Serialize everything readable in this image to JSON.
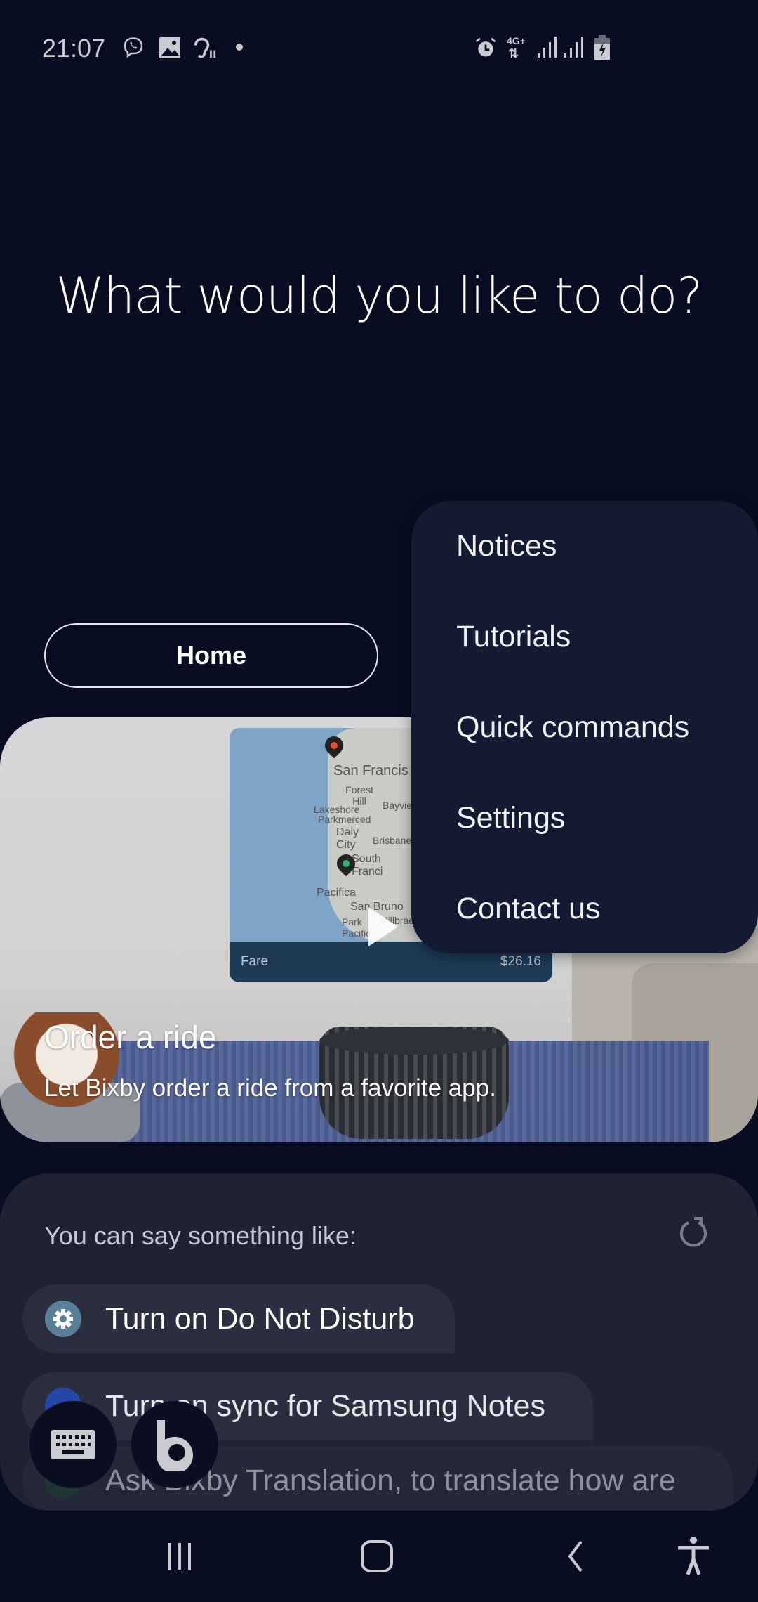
{
  "status_bar": {
    "time": "21:07",
    "left_icons": [
      "viber-icon",
      "gallery-icon",
      "hearing-icon",
      "dot-icon"
    ],
    "right_icons": [
      "alarm-icon",
      "4g-plus-icon",
      "signal-icon",
      "signal-icon",
      "battery-charging-icon"
    ],
    "network": "4G+"
  },
  "header": {
    "title": "What would you like to do?"
  },
  "home_button": {
    "label": "Home"
  },
  "card": {
    "title": "Order a ride",
    "subtitle": "Let Bixby order a ride from a favorite app.",
    "map": {
      "labels": [
        "San Francis",
        "Forest Hill",
        "Lakeshore",
        "Parkmerced",
        "Daly City",
        "Brisbane",
        "Bayview",
        "South Franci",
        "Pacifica",
        "San Bruno",
        "Park Pacific",
        "Millbrae"
      ],
      "fare_label": "Fare",
      "fare_value": "$26.16"
    }
  },
  "menu": {
    "items": [
      {
        "label": "Notices"
      },
      {
        "label": "Tutorials"
      },
      {
        "label": "Quick commands"
      },
      {
        "label": "Settings"
      },
      {
        "label": "Contact us"
      }
    ]
  },
  "suggestions": {
    "heading": "You can say something like:",
    "items": [
      {
        "label": "Turn on Do Not Disturb",
        "icon": "settings-gear-icon",
        "color": "#5a7f99"
      },
      {
        "label": "Turn on sync for Samsung Notes",
        "icon": "samsung-cloud-icon",
        "color": "#2447a8"
      },
      {
        "label": "Ask Bixby Translation, to translate how are",
        "icon": "translation-icon",
        "color": "#1f4a3a"
      }
    ]
  },
  "fabs": [
    {
      "icon": "keyboard-icon"
    },
    {
      "icon": "bixby-icon"
    }
  ],
  "nav_bar": {
    "icons": [
      "recents-icon",
      "home-icon",
      "back-icon",
      "accessibility-icon"
    ]
  },
  "colors": {
    "background": "#090d22",
    "menu": "#121b31",
    "panel": "#1f2233",
    "chip": "#2a2e3e"
  }
}
